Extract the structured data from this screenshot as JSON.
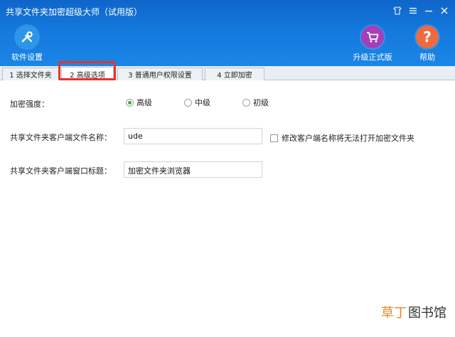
{
  "window": {
    "title": "共享文件夹加密超级大师（试用版）"
  },
  "toolbar": {
    "settings_label": "软件设置",
    "upgrade_label": "升级正式版",
    "help_label": "帮助"
  },
  "tabs": [
    {
      "label": "1 选择文件夹"
    },
    {
      "label": "2 高级选项"
    },
    {
      "label": "3 普通用户权限设置"
    },
    {
      "label": "4 立即加密"
    }
  ],
  "form": {
    "strength_label": "加密强度：",
    "strength_options": [
      "高级",
      "中级",
      "初级"
    ],
    "strength_selected": "高级",
    "client_name_label": "共享文件夹客户端文件名称：",
    "client_name_value": "ude",
    "modify_warning_label": "修改客户端名称将无法打开加密文件夹",
    "window_title_label": "共享文件夹客户端窗口标题：",
    "window_title_value": "加密文件夹浏览器"
  },
  "watermark": {
    "text_a": "草丁",
    "text_b": "图书馆"
  },
  "colors": {
    "accent_blue": "#1479dd",
    "highlight_red": "#e8332b",
    "radio_green": "#3aa83a"
  }
}
